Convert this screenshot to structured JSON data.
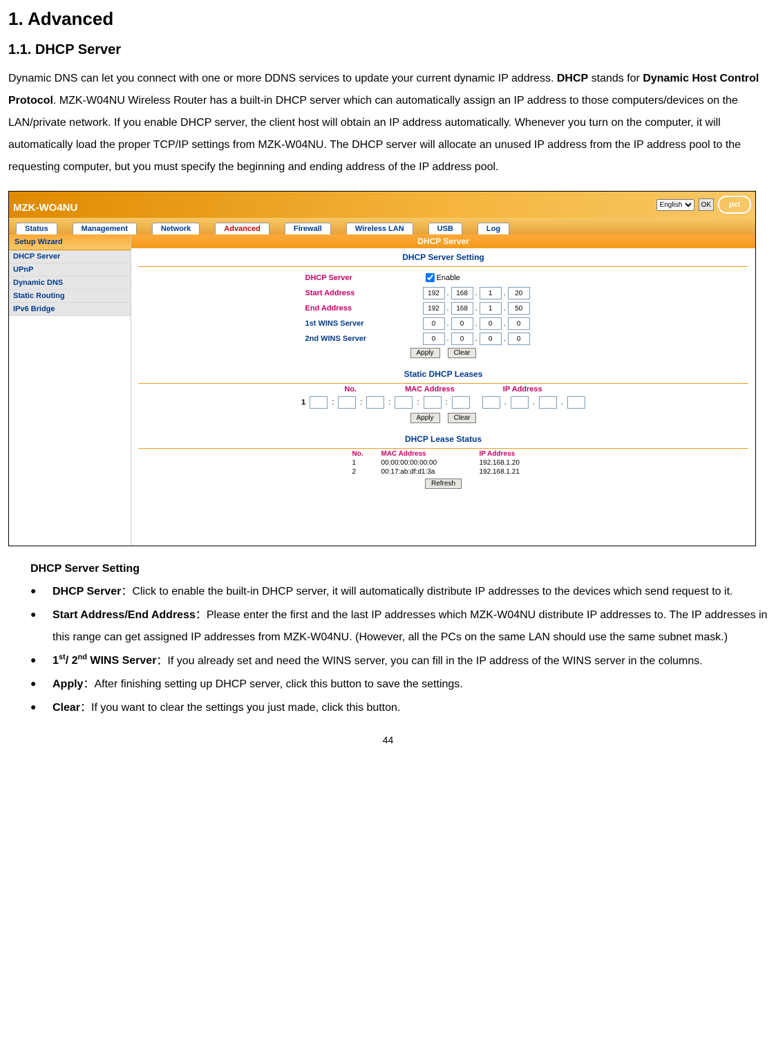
{
  "doc": {
    "h1": "1. Advanced",
    "h2": "1.1.    DHCP Server",
    "para_pre": "Dynamic DNS can let you connect with one or more DDNS services to update your current dynamic IP address. ",
    "para_dhcp": "DHCP",
    "para_mid": " stands for ",
    "para_full": "Dynamic Host Control Protocol",
    "para_rest": ". MZK-W04NU Wireless Router has a built-in DHCP server which can automatically assign an IP address to those computers/devices on the LAN/private network. If you enable DHCP server, the client host will obtain an IP address automatically. Whenever you turn on the computer, it will automatically load the proper TCP/IP settings from MZK-W04NU. The DHCP server will allocate an unused IP address from the IP address pool to the requesting computer, but you must specify the beginning and ending address of the IP address pool."
  },
  "shot": {
    "model": "MZK-WO4NU",
    "lang": "English",
    "ok": "OK",
    "logo": "pci",
    "tabs": [
      "Status",
      "Management",
      "Network",
      "Advanced",
      "Firewall",
      "Wireless LAN",
      "USB",
      "Log"
    ],
    "activeTabIndex": 3,
    "sidebar": {
      "wizard": "Setup Wizard",
      "items": [
        "DHCP Server",
        "UPnP",
        "Dynamic DNS",
        "Static Routing",
        "IPv6 Bridge"
      ]
    },
    "page_title": "DHCP Server",
    "section1": "DHCP Server Setting",
    "labels": {
      "dhcp_server": "DHCP Server",
      "enable": "Enable",
      "start_addr": "Start Address",
      "end_addr": "End Address",
      "wins1": "1st WINS Server",
      "wins2": "2nd WINS Server"
    },
    "ips": {
      "start": [
        "192",
        "168",
        "1",
        "20"
      ],
      "end": [
        "192",
        "168",
        "1",
        "50"
      ],
      "wins1": [
        "0",
        "0",
        "0",
        "0"
      ],
      "wins2": [
        "0",
        "0",
        "0",
        "0"
      ]
    },
    "buttons": {
      "apply": "Apply",
      "clear": "Clear",
      "refresh": "Refresh"
    },
    "section2": "Static DHCP Leases",
    "leases": {
      "col_no": "No.",
      "col_mac": "MAC Address",
      "col_ip": "IP Address",
      "row_no": "1"
    },
    "section3": "DHCP Lease Status",
    "status": {
      "col_no": "No.",
      "col_mac": "MAC Address",
      "col_ip": "IP Address",
      "rows": [
        {
          "no": "1",
          "mac": "00:00:00:00:00:00",
          "ip": "192.168.1.20"
        },
        {
          "no": "2",
          "mac": "00:17:ab:df:d1:3a",
          "ip": "192.168.1.21"
        }
      ]
    }
  },
  "after": {
    "heading": "DHCP Server Setting",
    "bullets": {
      "b1_label": "DHCP Server",
      "b1_text": "：Click to enable the built-in DHCP server, it will automatically distribute IP addresses to the devices which send request to it.",
      "b2_label": "Start Address/End Address",
      "b2_text": "：Please enter the first and the last IP addresses which MZK-W04NU distribute IP addresses to. The IP addresses in this range can get assigned IP addresses from MZK-W04NU. (However, all the PCs on the same LAN should use the same subnet mask.)",
      "b3_label_pre": "1",
      "b3_label_sup1": "st",
      "b3_label_mid": "/ 2",
      "b3_label_sup2": "nd",
      "b3_label_post": " WINS Server",
      "b3_text": "：If you already set and need the WINS server, you can fill in the IP address of the WINS server in the columns.",
      "b4_label": "Apply",
      "b4_text": "：After finishing setting up DHCP server, click this button to save the settings.",
      "b5_label": "Clear",
      "b5_text": "：If you want to clear the settings you just made, click this button."
    }
  },
  "pageNum": "44"
}
